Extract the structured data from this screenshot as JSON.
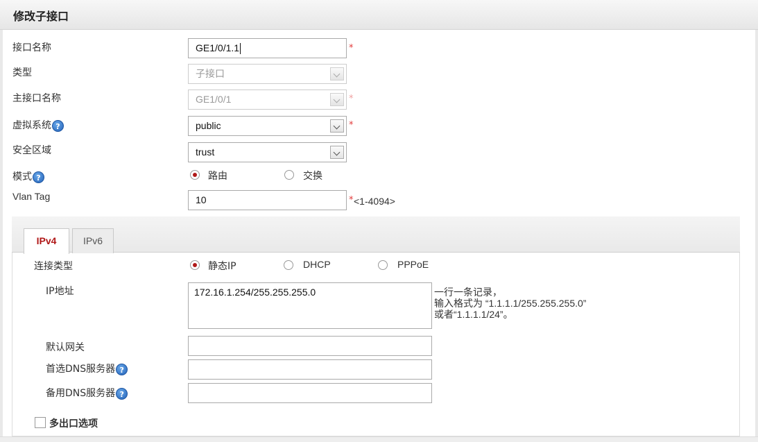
{
  "header": {
    "title": "修改子接口"
  },
  "form": {
    "interface_name": {
      "label": "接口名称",
      "value": "GE1/0/1.1",
      "required": "*"
    },
    "type": {
      "label": "类型",
      "value": "子接口"
    },
    "parent_interface": {
      "label": "主接口名称",
      "value": "GE1/0/1",
      "required": "*"
    },
    "virtual_system": {
      "label": "虚拟系统",
      "value": "public",
      "required": "*"
    },
    "security_zone": {
      "label": "安全区域",
      "value": "trust"
    },
    "mode": {
      "label": "模式",
      "options": [
        "路由",
        "交换"
      ],
      "selected": "路由"
    },
    "vlan_tag": {
      "label": "Vlan Tag",
      "value": "10",
      "required": "*",
      "range": "<1-4094>"
    }
  },
  "tabs": [
    {
      "label": "IPv4",
      "active": true
    },
    {
      "label": "IPv6",
      "active": false
    }
  ],
  "ipv4": {
    "connection_type": {
      "label": "连接类型",
      "options": [
        "静态IP",
        "DHCP",
        "PPPoE"
      ],
      "selected": "静态IP"
    },
    "ip_address": {
      "label": "IP地址",
      "value": "172.16.1.254/255.255.255.0",
      "hint_lines": [
        "一行一条记录，",
        "输入格式为 “1.1.1.1/255.255.255.0”",
        "或者“1.1.1.1/24”。"
      ]
    },
    "default_gateway": {
      "label": "默认网关",
      "value": ""
    },
    "primary_dns": {
      "label": "首选DNS服务器",
      "value": ""
    },
    "secondary_dns": {
      "label": "备用DNS服务器",
      "value": ""
    },
    "multi_exit": {
      "label": "多出口选项",
      "checked": false
    }
  },
  "icons": {
    "help": "help-icon",
    "radio": "radio-icon",
    "dropdown": "chevron-down-icon"
  },
  "colors": {
    "accent": "#b01818",
    "required": "#e23c3c",
    "help": "#2362b8"
  }
}
